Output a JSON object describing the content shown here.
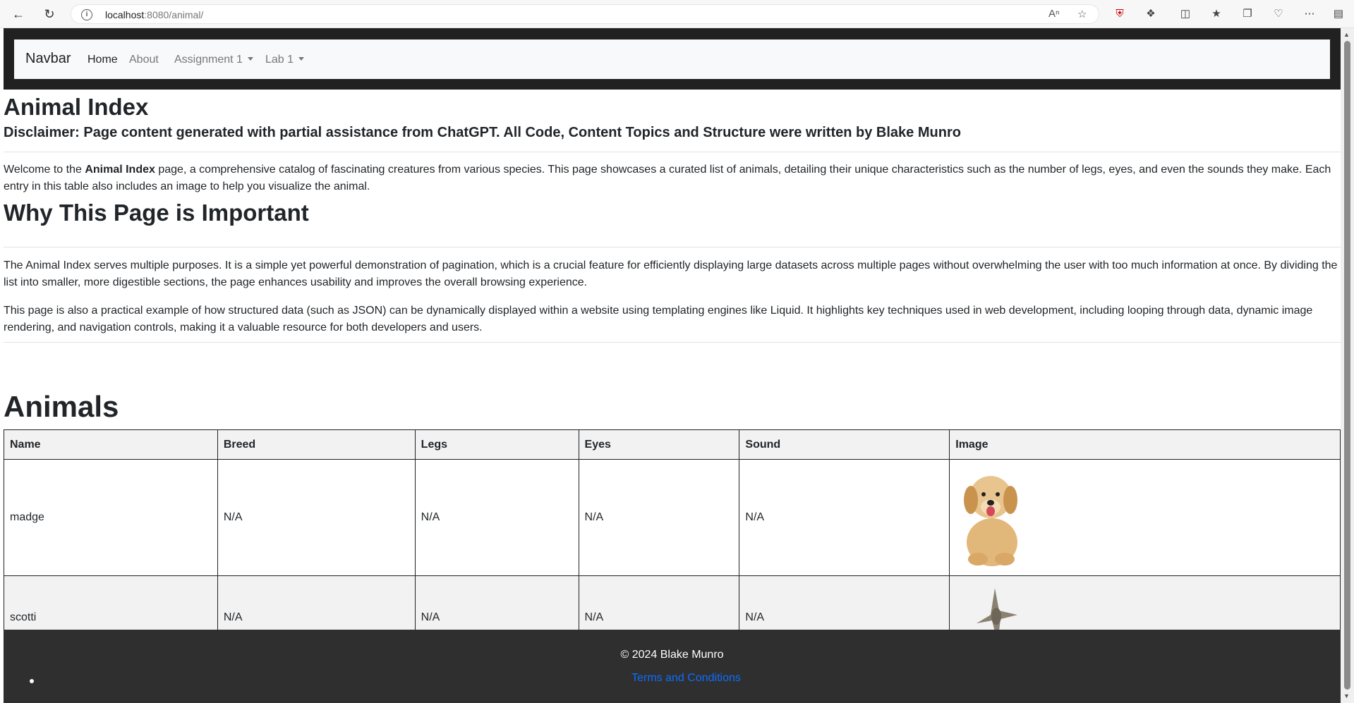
{
  "browser": {
    "url_host": "localhost",
    "url_path": ":8080/animal/"
  },
  "navbar": {
    "brand": "Navbar",
    "links": [
      {
        "label": "Home"
      },
      {
        "label": "About"
      },
      {
        "label": "Assignment 1"
      },
      {
        "label": "Lab 1"
      }
    ]
  },
  "page": {
    "title": "Animal Index",
    "disclaimer": "Disclaimer: Page content generated with partial assistance from ChatGPT. All Code, Content Topics and Structure were written by Blake Munro",
    "intro_before": "Welcome to the ",
    "intro_bold": "Animal Index",
    "intro_after": " page, a comprehensive catalog of fascinating creatures from various species. This page showcases a curated list of animals, detailing their unique characteristics such as the number of legs, eyes, and even the sounds they make. Each entry in this table also includes an image to help you visualize the animal.",
    "why_heading": "Why This Page is Important",
    "why_p1": "The Animal Index serves multiple purposes. It is a simple yet powerful demonstration of pagination, which is a crucial feature for efficiently displaying large datasets across multiple pages without overwhelming the user with too much information at once. By dividing the list into smaller, more digestible sections, the page enhances usability and improves the overall browsing experience.",
    "why_p2": "This page is also a practical example of how structured data (such as JSON) can be dynamically displayed within a website using templating engines like Liquid. It highlights key techniques used in web development, including looping through data, dynamic image rendering, and navigation controls, making it a valuable resource for both developers and users.",
    "animals_heading": "Animals"
  },
  "table": {
    "headers": [
      "Name",
      "Breed",
      "Legs",
      "Eyes",
      "Sound",
      "Image"
    ],
    "rows": [
      {
        "name": "madge",
        "breed": "N/A",
        "legs": "N/A",
        "eyes": "N/A",
        "sound": "N/A",
        "image": "puppy"
      },
      {
        "name": "scotti",
        "breed": "N/A",
        "legs": "N/A",
        "eyes": "N/A",
        "sound": "N/A",
        "image": "bird"
      }
    ]
  },
  "footer": {
    "copyright": "© 2024 Blake Munro",
    "terms": "Terms and Conditions"
  }
}
